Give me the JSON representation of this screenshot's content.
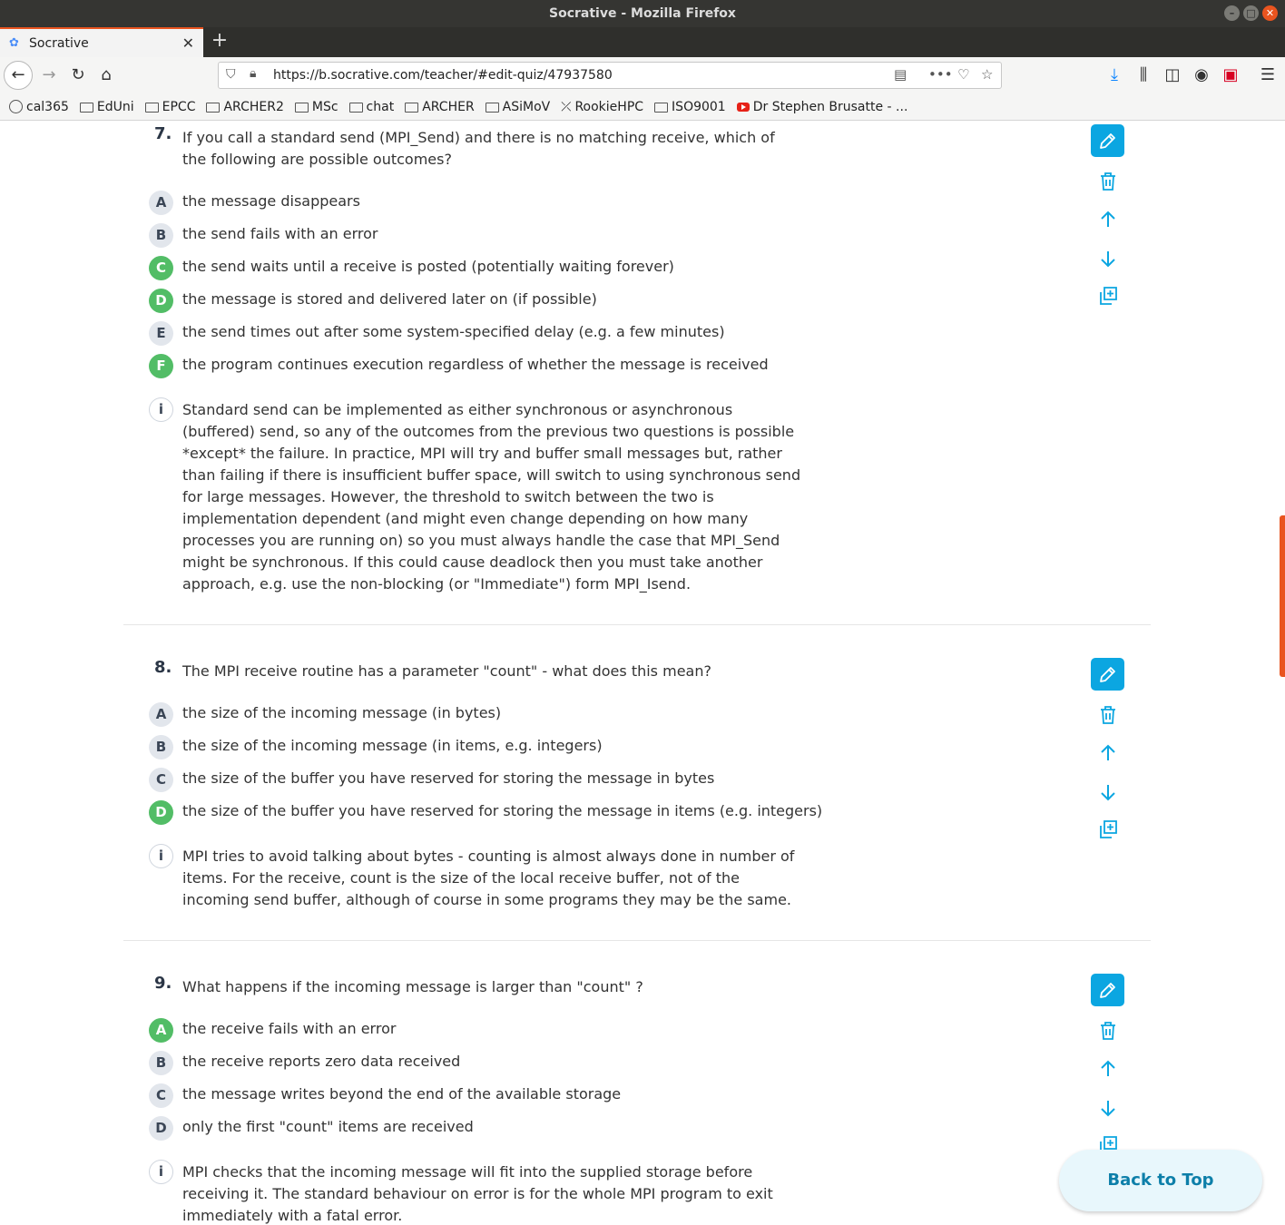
{
  "window": {
    "title": "Socrative - Mozilla Firefox"
  },
  "tab": {
    "label": "Socrative",
    "favicon": "socrative-icon"
  },
  "urlbar": {
    "url": "https://b.socrative.com/teacher/#edit-quiz/47937580"
  },
  "bookmarks": [
    {
      "label": "cal365",
      "icon": "globe-icon"
    },
    {
      "label": "EdUni",
      "icon": "folder-icon"
    },
    {
      "label": "EPCC",
      "icon": "folder-icon"
    },
    {
      "label": "ARCHER2",
      "icon": "folder-icon"
    },
    {
      "label": "MSc",
      "icon": "folder-icon"
    },
    {
      "label": "chat",
      "icon": "folder-icon"
    },
    {
      "label": "ARCHER",
      "icon": "folder-icon"
    },
    {
      "label": "ASiMoV",
      "icon": "folder-icon"
    },
    {
      "label": "RookieHPC",
      "icon": "rookie-icon"
    },
    {
      "label": "ISO9001",
      "icon": "folder-icon"
    },
    {
      "label": "Dr Stephen Brusatte - ...",
      "icon": "youtube-icon"
    }
  ],
  "questions": [
    {
      "number": "7.",
      "text": "If you call a standard send (MPI_Send) and there is no matching receive, which of the following are possible outcomes?",
      "answers": [
        {
          "letter": "A",
          "text": "the message disappears",
          "correct": false
        },
        {
          "letter": "B",
          "text": "the send fails with an error",
          "correct": false
        },
        {
          "letter": "C",
          "text": "the send waits until a receive is posted (potentially waiting forever)",
          "correct": true
        },
        {
          "letter": "D",
          "text": "the message is stored and delivered later on (if possible)",
          "correct": true
        },
        {
          "letter": "E",
          "text": "the send times out after some system-specified delay (e.g. a few minutes)",
          "correct": false
        },
        {
          "letter": "F",
          "text": "the program continues execution regardless of whether the message is received",
          "correct": true
        }
      ],
      "explanation_icon": "i",
      "explanation": "Standard send can be implemented as either synchronous or asynchronous (buffered) send, so any of the outcomes from the previous two questions is possible *except* the failure. In practice, MPI will try and buffer small messages but, rather than failing if there is insufficient buffer space, will switch to using synchronous send for large messages. However, the threshold to switch between the two is implementation dependent (and might even change depending on how many processes you are running on) so you must always handle the case that MPI_Send might be synchronous. If this could cause deadlock then you must take another approach, e.g. use the non-blocking (or \"Immediate\") form MPI_Isend."
    },
    {
      "number": "8.",
      "text": "The MPI receive routine has a parameter \"count\" - what does this mean?",
      "answers": [
        {
          "letter": "A",
          "text": "the size of the incoming message (in bytes)",
          "correct": false
        },
        {
          "letter": "B",
          "text": "the size of the incoming message (in items, e.g. integers)",
          "correct": false
        },
        {
          "letter": "C",
          "text": "the size of the buffer you have reserved for storing the message in bytes",
          "correct": false
        },
        {
          "letter": "D",
          "text": "the size of the buffer you have reserved for storing the message in items (e.g. integers)",
          "correct": true
        }
      ],
      "explanation_icon": "i",
      "explanation": "MPI tries to avoid talking about bytes - counting is almost always done in number of items. For the receive, count is the size of the local receive buffer, not of the incoming send buffer, although of course in some programs they may be the same."
    },
    {
      "number": "9.",
      "text": "What happens if the incoming message is larger than \"count\" ?",
      "answers": [
        {
          "letter": "A",
          "text": "the receive fails with an error",
          "correct": true
        },
        {
          "letter": "B",
          "text": "the receive reports zero data received",
          "correct": false
        },
        {
          "letter": "C",
          "text": "the message writes beyond the end of the available storage",
          "correct": false
        },
        {
          "letter": "D",
          "text": "only the first \"count\" items are received",
          "correct": false
        }
      ],
      "explanation_icon": "i",
      "explanation": "MPI checks that the incoming message will fit into the supplied storage before receiving it. The standard behaviour on error is for the whole MPI program to exit immediately with a fatal error."
    }
  ],
  "back_to_top": {
    "label": "Back to Top"
  },
  "colors": {
    "accent": "#0ba6e1",
    "correct": "#52bd66",
    "letter_bg": "#e2e6ec"
  }
}
